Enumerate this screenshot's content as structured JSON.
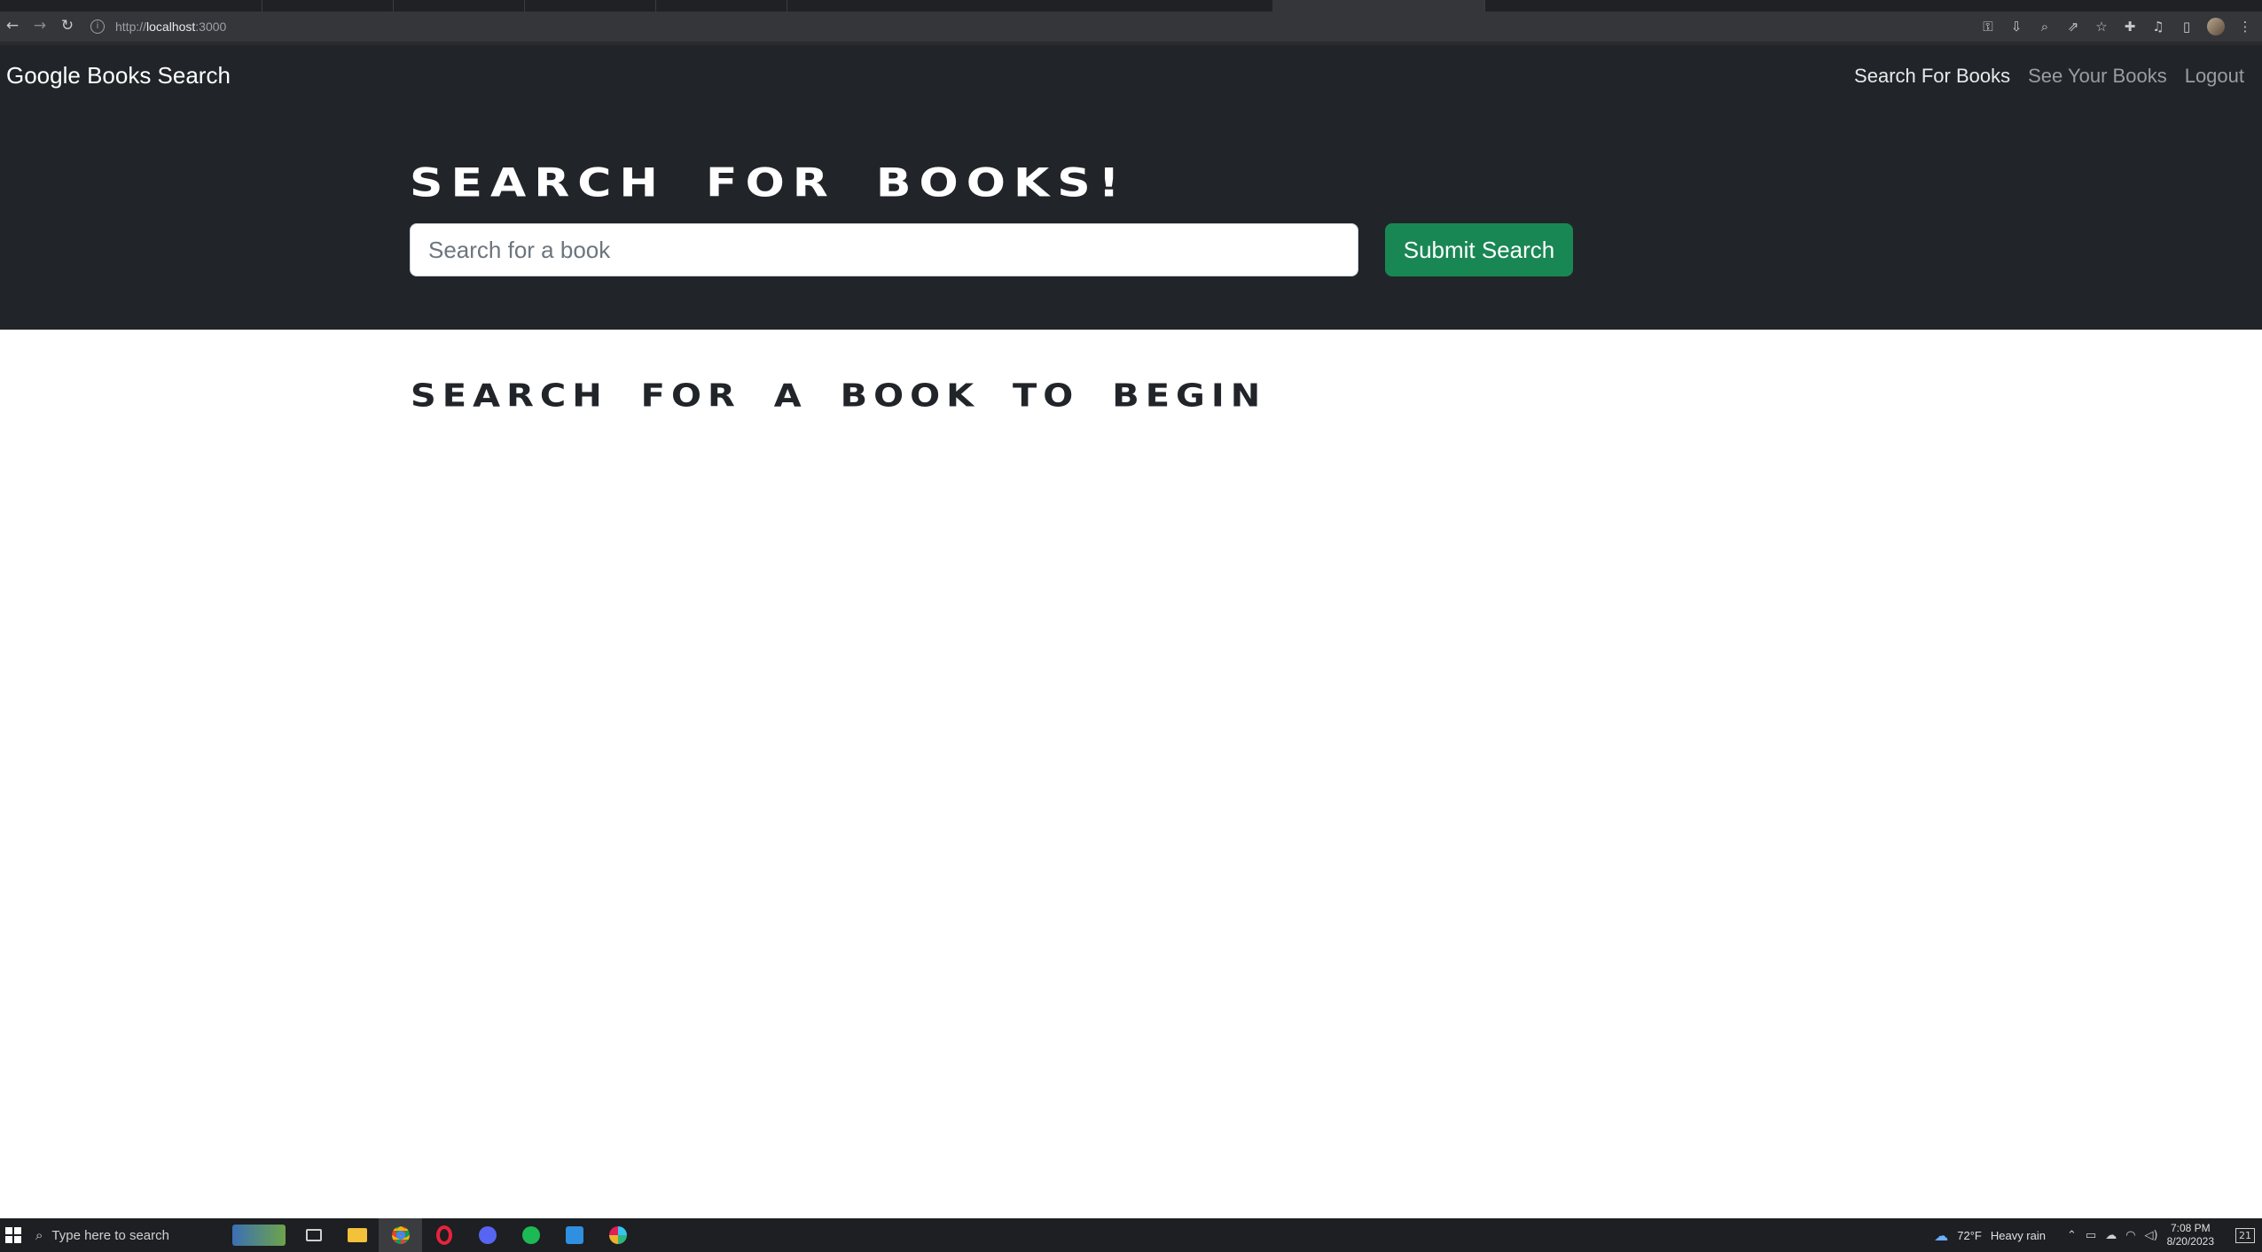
{
  "browser": {
    "url_scheme": "http://",
    "url_host": "localhost",
    "url_port": ":3000",
    "icons": [
      "back-icon",
      "forward-icon",
      "reload-icon",
      "info-icon",
      "key-icon",
      "install-icon",
      "zoom-icon",
      "share-icon",
      "star-icon",
      "extensions-icon",
      "media-icon",
      "sidepanel-icon",
      "profile-avatar",
      "menu-icon"
    ]
  },
  "app": {
    "brand": "Google Books Search",
    "nav": {
      "search": "Search For Books",
      "saved": "See Your Books",
      "logout": "Logout"
    },
    "hero": {
      "title": "SEARCH FOR BOOKS!",
      "placeholder": "Search for a book",
      "submit_label": "Submit Search"
    },
    "results_heading": "SEARCH FOR A BOOK TO BEGIN",
    "colors": {
      "dark": "#212529",
      "success": "#198754"
    }
  },
  "taskbar": {
    "search_placeholder": "Type here to search",
    "weather_temp": "72°F",
    "weather_text": "Heavy rain",
    "time": "7:08 PM",
    "date": "8/20/2023",
    "notification_count": "21"
  }
}
